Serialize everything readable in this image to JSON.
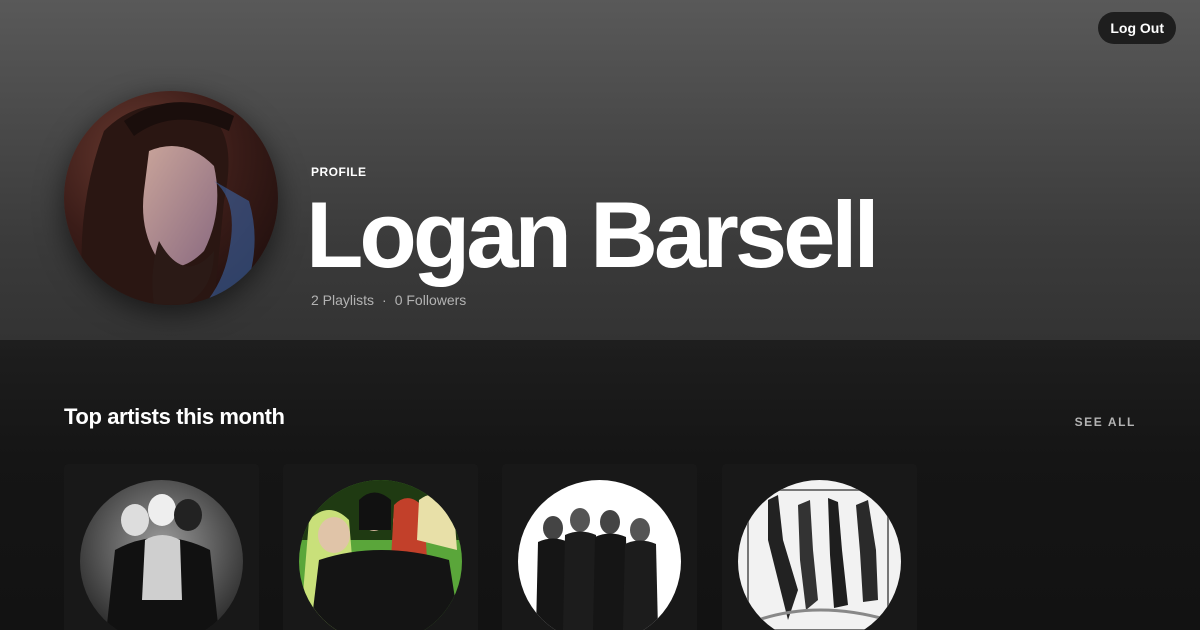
{
  "header": {
    "logout_label": "Log Out"
  },
  "profile": {
    "label": "PROFILE",
    "name": "Logan Barsell",
    "playlists": "2 Playlists",
    "separator": "·",
    "followers": "0 Followers"
  },
  "top_artists": {
    "title": "Top artists this month",
    "see_all_label": "SEE ALL"
  }
}
